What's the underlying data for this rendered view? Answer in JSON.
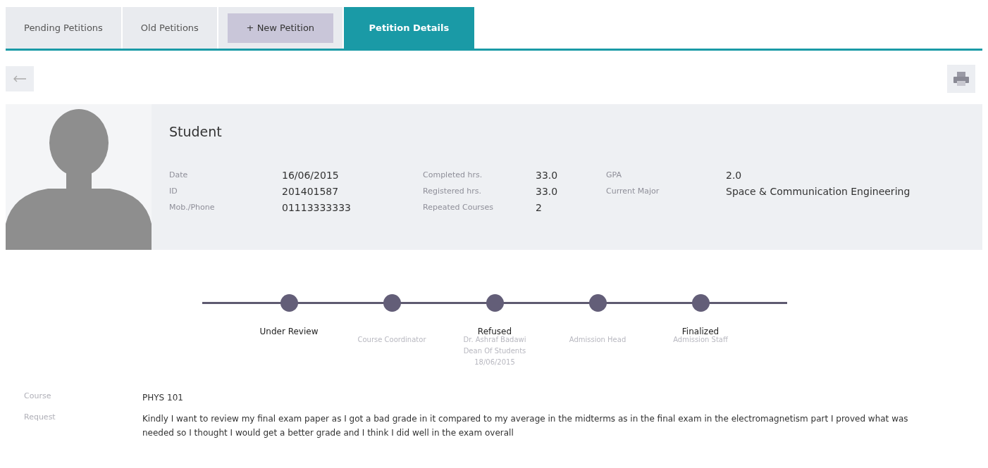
{
  "tabs": [
    {
      "label": "Pending Petitions",
      "kind": "tab",
      "selected": false
    },
    {
      "label": "Old Petitions",
      "kind": "tab",
      "selected": false
    },
    {
      "label": "+ New Petition",
      "kind": "button",
      "selected": false
    },
    {
      "label": "Petition Details",
      "kind": "tab",
      "selected": true
    }
  ],
  "student": {
    "name": "Student",
    "fields": [
      [
        {
          "label": "Date",
          "value": "16/06/2015"
        },
        {
          "label": "ID",
          "value": "201401587"
        },
        {
          "label": "Mob./Phone",
          "value": "01113333333"
        }
      ],
      [
        {
          "label": "Completed hrs.",
          "value": "33.0"
        },
        {
          "label": "Registered hrs.",
          "value": "33.0"
        },
        {
          "label": "Repeated Courses",
          "value": "2"
        }
      ],
      [
        {
          "label": "GPA",
          "value": "2.0"
        },
        {
          "label": "Current Major",
          "value": "Space & Communication Engineering"
        }
      ]
    ]
  },
  "timeline": [
    {
      "status": "Under Review"
    },
    {
      "details": [
        "Course Coordinator"
      ]
    },
    {
      "status": "Refused",
      "details": [
        "Dr. Ashraf Badawi",
        "Dean Of Students",
        "18/06/2015"
      ]
    },
    {
      "details": [
        "Admission Head"
      ]
    },
    {
      "status": "Finalized",
      "details": [
        "Admission Staff"
      ]
    }
  ],
  "petition": [
    {
      "label": "Course",
      "value": "PHYS 101"
    },
    {
      "label": "Request",
      "value": "Kindly I want to review my final exam paper as I got a bad grade in it compared to my average in the midterms as in the final exam in the electromagnetism part I proved what was needed so I thought I would get a better grade and I think I did well in the exam overall"
    }
  ]
}
